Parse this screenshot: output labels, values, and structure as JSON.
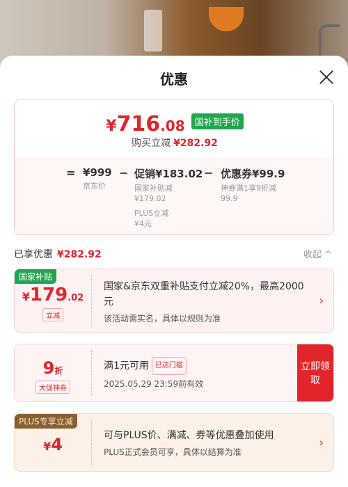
{
  "sheet": {
    "title": "优惠"
  },
  "summary": {
    "currency": "¥",
    "price_int": "716",
    "price_dec": ".08",
    "badge": "国补到手价",
    "save_label": "购买立减",
    "save_amount": "¥282.92",
    "formula": {
      "equals": "=",
      "original_value": "¥999",
      "original_label": "京东价",
      "minus1": "−",
      "promo_value": "促销¥183.02",
      "promo_sub1_label": "国家补贴减",
      "promo_sub1_value": "¥179.02",
      "promo_sub2_label": "PLUS立减",
      "promo_sub2_value": "¥4元",
      "minus2": "−",
      "coupon_value": "优惠券¥99.9",
      "coupon_sub_label": "神券满1享9折减",
      "coupon_sub_value": "99.9"
    }
  },
  "enjoyed": {
    "label": "已享优惠",
    "amount": "¥282.92",
    "collapse": "收起 ^"
  },
  "cards": [
    {
      "tag": "国家补贴",
      "currency": "¥",
      "amount_int": "179",
      "amount_dec": ".02",
      "amount_tag": "立减",
      "text": "国家&京东双重补贴支付立减20%，最高2000元",
      "sub": "该活动需实名，具体以规则为准"
    },
    {
      "amount_int": "9",
      "amount_unit": "折",
      "amount_tag": "大促神券",
      "text": "满1元可用",
      "text_tag": "已达门槛",
      "sub": "2025.05.29 23:59前有效",
      "claim": "立即领取"
    },
    {
      "tag": "PLUS专享立减",
      "currency": "¥",
      "amount_int": "4",
      "text": "可与PLUS价、满减、券等优惠叠加使用",
      "sub": "PLUS正式会员可享，具体以结算为准"
    }
  ],
  "colors": {
    "accent": "#e1252b",
    "green": "#21a64e",
    "plus_brown": "#8a5f32"
  }
}
